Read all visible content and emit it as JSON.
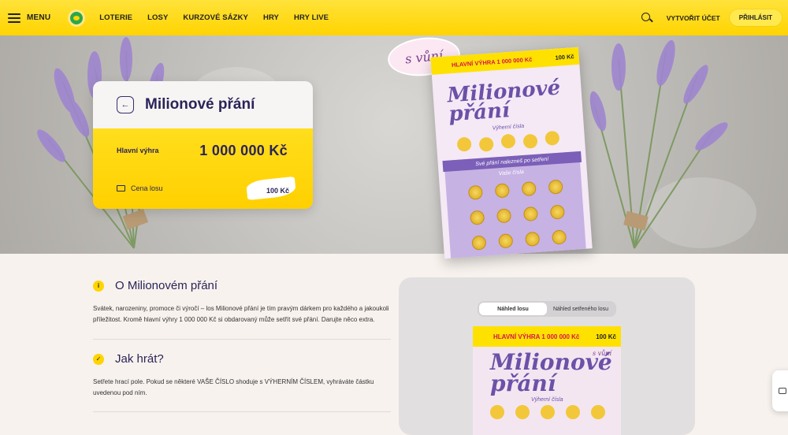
{
  "header": {
    "menu_label": "MENU",
    "nav": [
      "LOTERIE",
      "LOSY",
      "KURZOVÉ SÁZKY",
      "HRY",
      "HRY LIVE"
    ],
    "create_account": "VYTVOŘIT ÚČET",
    "login": "PŘIHLÁSIT"
  },
  "hero": {
    "title": "Milionové přání",
    "main_prize_label": "Hlavní výhra",
    "main_prize_value": "1 000 000 Kč",
    "ticket_price_label": "Cena losu",
    "ticket_price_value": "100 Kč",
    "ticket_band": "HLAVNÍ VÝHRA 1 000 000 Kč",
    "ticket_price_small": "100 Kč",
    "ticket_title": "Milionové přání",
    "badge": "s vůní",
    "ticket_label": "Výherní čísla",
    "ticket_strip": "Své přání nalezneš po setření",
    "ticket_label2": "Vaše čísla"
  },
  "about": {
    "title": "O Milionovém přání",
    "text": "Svátek, narozeniny, promoce či výročí – los Milionové přání je tím pravým dárkem pro každého a jakoukoli příležitost. Kromě hlavní výhry 1 000 000 Kč si obdarovaný může setřít své přání. Darujte něco extra."
  },
  "howto": {
    "title": "Jak hrát?",
    "text": "Setřete hrací pole. Pokud se některé VAŠE ČÍSLO shoduje s VÝHERNÍM ČÍSLEM, vyhráváte částku uvedenou pod ním."
  },
  "preview": {
    "tab1": "Náhled losu",
    "tab2": "Náhled setřeného losu",
    "band": "HLAVNÍ VÝHRA 1 000 000 Kč",
    "price": "100 Kč",
    "badge": "s vůní",
    "title": "Milionové přání",
    "label": "Výherní čísla"
  },
  "colors": {
    "brand_yellow": "#ffd400",
    "title_purple": "#2b2358",
    "ticket_purple": "#6d50a8",
    "ticket_red": "#d5124c"
  },
  "icons": [
    "hamburger-icon",
    "logo-icon",
    "search-icon",
    "back-arrow-icon",
    "ticket-icon",
    "info-icon",
    "check-icon",
    "chat-icon"
  ]
}
